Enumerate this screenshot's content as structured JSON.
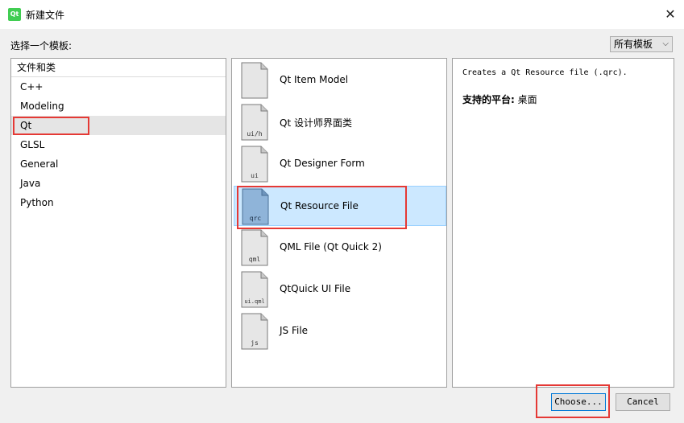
{
  "window": {
    "title": "新建文件",
    "app_icon_text": "Qt",
    "close_glyph": "✕"
  },
  "prompt_label": "选择一个模板:",
  "template_filter": {
    "selected": "所有模板",
    "arrow_glyph": "⌵"
  },
  "categories": {
    "header": "文件和类",
    "items": [
      {
        "label": "C++"
      },
      {
        "label": "Modeling"
      },
      {
        "label": "Qt"
      },
      {
        "label": "GLSL"
      },
      {
        "label": "General"
      },
      {
        "label": "Java"
      },
      {
        "label": "Python"
      }
    ],
    "selected_index": 2
  },
  "files": [
    {
      "label": "Qt Item Model",
      "icon_text": ""
    },
    {
      "label": "Qt 设计师界面类",
      "icon_text": "ui/h"
    },
    {
      "label": "Qt Designer Form",
      "icon_text": "ui"
    },
    {
      "label": "Qt Resource File",
      "icon_text": "qrc"
    },
    {
      "label": "QML File (Qt Quick 2)",
      "icon_text": "qml"
    },
    {
      "label": "QtQuick UI File",
      "icon_text": "ui.qml"
    },
    {
      "label": "JS File",
      "icon_text": "js"
    }
  ],
  "selected_file_index": 3,
  "description": {
    "text": "Creates a Qt Resource file (.qrc).",
    "platform_label": "支持的平台:",
    "platform_value": "桌面"
  },
  "buttons": {
    "choose": "Choose...",
    "cancel": "Cancel"
  },
  "colors": {
    "selection": "#cce8ff",
    "highlight_box": "#e53935",
    "accent": "#0078d7"
  }
}
